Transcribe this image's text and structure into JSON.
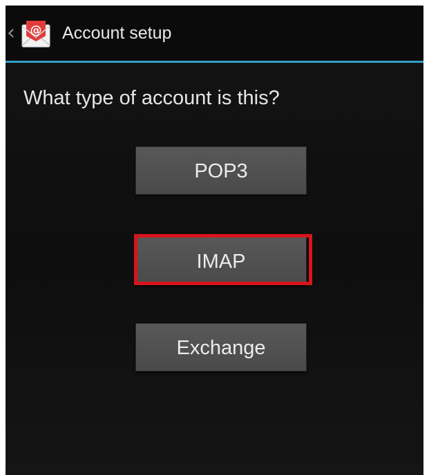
{
  "action_bar": {
    "title": "Account setup",
    "icon": "email-app-icon",
    "accent_color": "#33a2c8"
  },
  "main": {
    "question": "What type of account is this?",
    "options": [
      {
        "label": "POP3"
      },
      {
        "label": "IMAP",
        "highlighted": true
      },
      {
        "label": "Exchange"
      }
    ],
    "highlight_color": "#d8141c"
  }
}
